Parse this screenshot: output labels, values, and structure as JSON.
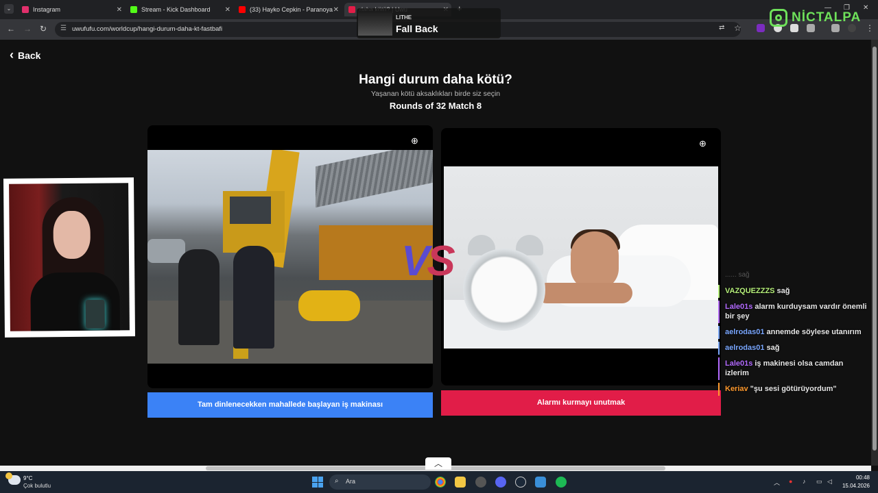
{
  "browser": {
    "tabs": [
      {
        "title": "Instagram",
        "favicon_color": "#e1306c"
      },
      {
        "title": "Stream - Kick Dashboard",
        "favicon_color": "#53fc18"
      },
      {
        "title": "(33) Hayko Cepkin - Paranoya",
        "favicon_color": "#ff0000"
      },
      {
        "title": "daha kötü? | Uwu",
        "favicon_color": "#e11d48"
      }
    ],
    "url": "uwufufu.com/worldcup/hangi-durum-daha-kt-fastbafi"
  },
  "now_playing": {
    "artist": "LITHE",
    "song": "Fall Back"
  },
  "logo": {
    "text": "NİCTALPA"
  },
  "page": {
    "back_label": "Back",
    "title": "Hangi durum daha kötü?",
    "subtitle": "Yaşanan kötü aksaklıkları birde siz seçin",
    "round_info": "Rounds of 32 Match 8",
    "vs_v": "V",
    "vs_s": "S",
    "option_left": "Tam dinlenecekken mahallede başlayan iş makinası",
    "option_right": "Alarmı kurmayı unutmak"
  },
  "chat": {
    "ghost": "...... sağ",
    "messages": [
      {
        "user": "VAZQUEZZZS",
        "color": "#b6f07a",
        "text": "sağ"
      },
      {
        "user": "Lale01s",
        "color": "#b36bff",
        "text": "alarm kurduysam vardır önemli bir şey"
      },
      {
        "user": "aelrodas01",
        "color": "#7aa7ff",
        "text": "annemde söylese utanırım"
      },
      {
        "user": "aelrodas01",
        "color": "#7aa7ff",
        "text": "sağ"
      },
      {
        "user": "Lale01s",
        "color": "#b36bff",
        "text": "iş makinesi olsa camdan izlerim"
      },
      {
        "user": "Keriav",
        "color": "#ff9a2e",
        "text": "\"şu sesi götürüyordum\""
      }
    ]
  },
  "taskbar": {
    "temp": "9°C",
    "condition": "Çok bulutlu",
    "search_label": "Ara",
    "time": "00:48",
    "date": "15.04.2026"
  }
}
